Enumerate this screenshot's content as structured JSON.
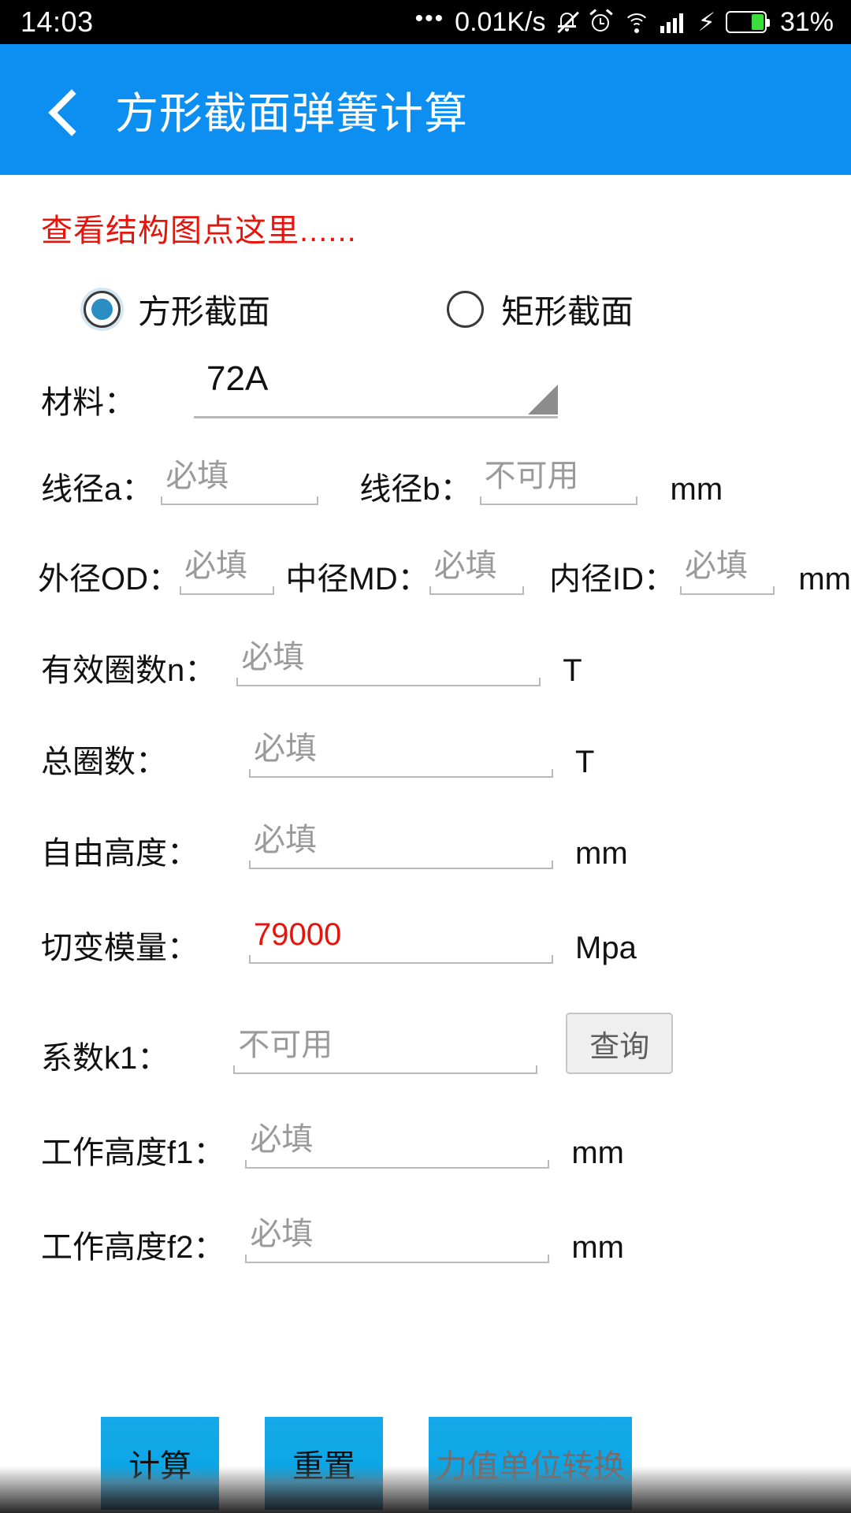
{
  "status_bar": {
    "time": "14:03",
    "dots": "•••",
    "net_speed": "0.01K/s",
    "battery_percent": "31%",
    "icons": [
      "mute-icon",
      "alarm-icon",
      "wifi-icon",
      "signal-icon",
      "charging-bolt-icon",
      "battery-icon"
    ]
  },
  "title_bar": {
    "back_label": "‹",
    "title": "方形截面弹簧计算"
  },
  "content": {
    "structure_link": "查看结构图点这里......",
    "section_type": {
      "options": [
        {
          "label": "方形截面",
          "selected": true
        },
        {
          "label": "矩形截面",
          "selected": false
        }
      ]
    },
    "material": {
      "label": "材料：",
      "value": "72A"
    },
    "rows": {
      "wire_a": {
        "label": "线径a：",
        "placeholder": "必填"
      },
      "wire_b": {
        "label": "线径b：",
        "placeholder": "不可用"
      },
      "wire_unit": "mm",
      "od": {
        "label": "外径OD：",
        "placeholder": "必填"
      },
      "md": {
        "label": "中径MD：",
        "placeholder": "必填"
      },
      "id": {
        "label": "内径ID：",
        "placeholder": "必填"
      },
      "diam_unit": "mm",
      "active_coils": {
        "label": "有效圈数n：",
        "placeholder": "必填",
        "unit": "T"
      },
      "total_coils": {
        "label": "总圈数：",
        "placeholder": "必填",
        "unit": "T"
      },
      "free_height": {
        "label": "自由高度：",
        "placeholder": "必填",
        "unit": "mm"
      },
      "shear_modulus": {
        "label": "切变模量：",
        "value": "79000",
        "unit": "Mpa"
      },
      "k1": {
        "label": "系数k1：",
        "placeholder": "不可用",
        "button": "查询"
      },
      "f1": {
        "label": "工作高度f1：",
        "placeholder": "必填",
        "unit": "mm"
      },
      "f2": {
        "label": "工作高度f2：",
        "placeholder": "必填",
        "unit": "mm"
      }
    }
  },
  "bottom_buttons": {
    "calculate": "计算",
    "reset": "重置",
    "convert": "力值单位转换"
  },
  "colors": {
    "header_blue": "#0d8ff2",
    "link_red": "#e8130b",
    "value_red": "#e8130b",
    "button_blue": "#0aa6e6",
    "radio_blue": "#2a8ec4",
    "battery_green": "#3ddc3d"
  }
}
